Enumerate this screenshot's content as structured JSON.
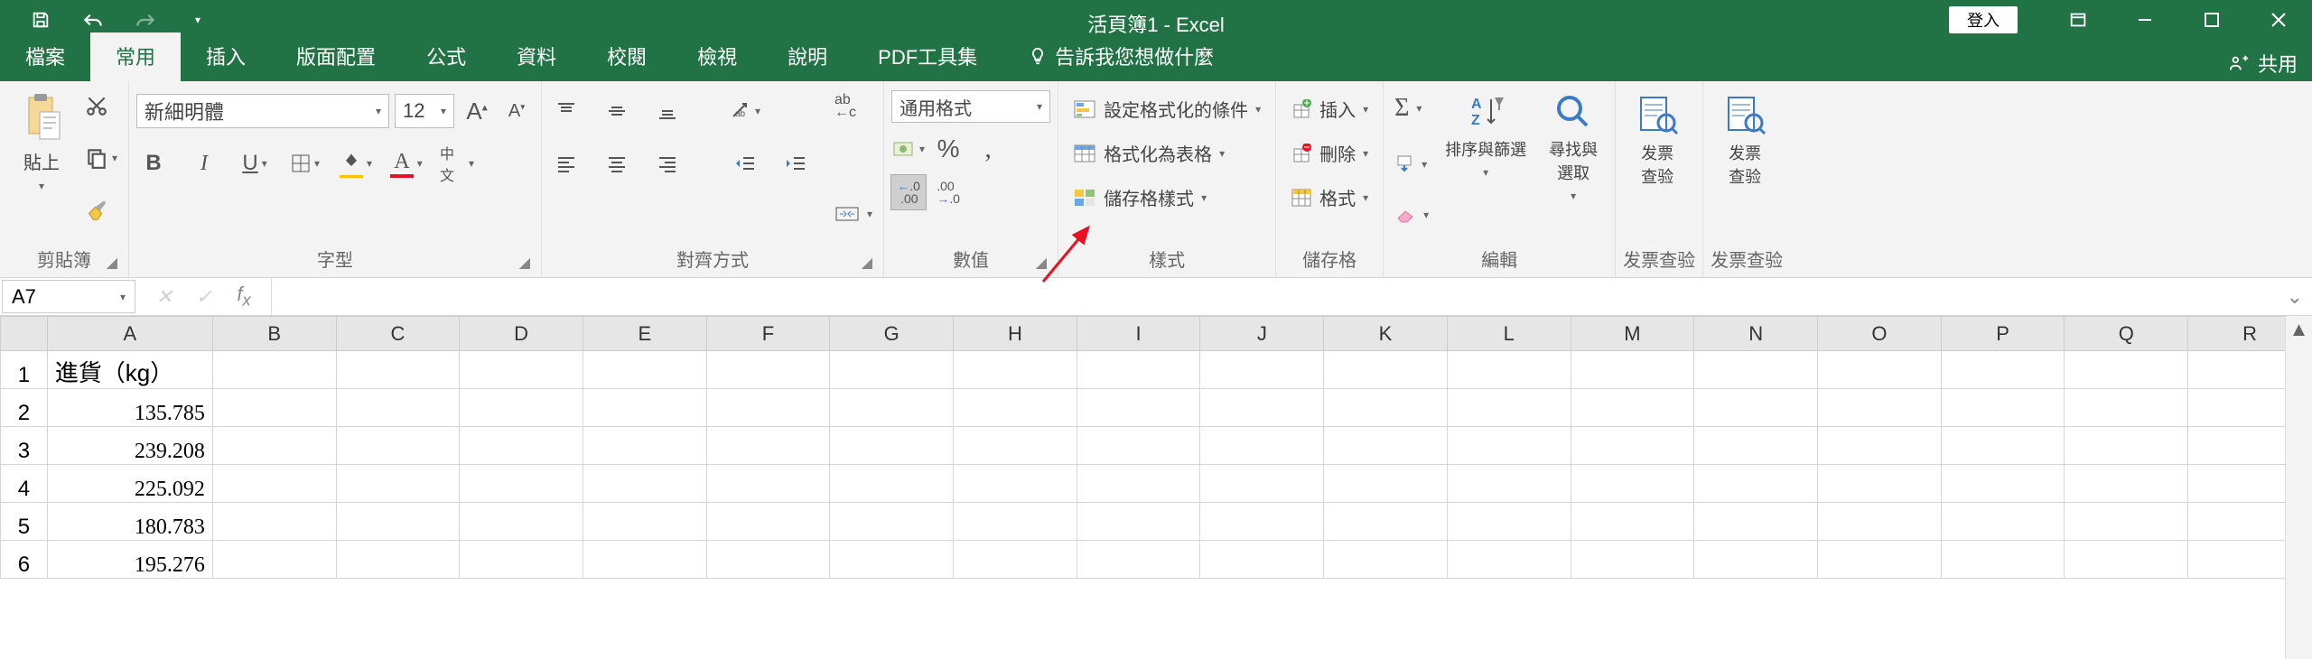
{
  "app_title": "活頁簿1 - Excel",
  "login_button": "登入",
  "share_label": "共用",
  "tellme_placeholder": "告訴我您想做什麼",
  "tabs": {
    "file": "檔案",
    "home": "常用",
    "insert": "插入",
    "layout": "版面配置",
    "formulas": "公式",
    "data": "資料",
    "review": "校閱",
    "view": "檢視",
    "help": "說明",
    "pdf": "PDF工具集"
  },
  "ribbon": {
    "clipboard": {
      "label": "剪貼簿",
      "paste": "貼上"
    },
    "font": {
      "label": "字型",
      "font_name": "新細明體",
      "font_size": "12",
      "phonetic": "中文"
    },
    "alignment": {
      "label": "對齊方式",
      "wrap": "ab"
    },
    "number": {
      "label": "數值",
      "format": "通用格式",
      "inc_decimal": ".00",
      "dec_decimal": ".00"
    },
    "styles": {
      "label": "樣式",
      "cond": "設定格式化的條件",
      "table": "格式化為表格",
      "cell": "儲存格樣式"
    },
    "cells": {
      "label": "儲存格",
      "insert": "插入",
      "delete": "刪除",
      "format": "格式"
    },
    "editing": {
      "label": "編輯",
      "sort_filter": "排序與篩選",
      "find_select": "尋找與\n選取"
    },
    "invoice1": {
      "label": "发票查验",
      "btn": "发票\n查验"
    },
    "invoice2": {
      "label": "发票查验",
      "btn": "发票\n查验"
    }
  },
  "namebox": "A7",
  "formula_value": "",
  "columns": [
    "A",
    "B",
    "C",
    "D",
    "E",
    "F",
    "G",
    "H",
    "I",
    "J",
    "K",
    "L",
    "M",
    "N",
    "O",
    "P",
    "Q",
    "R"
  ],
  "rows": [
    "1",
    "2",
    "3",
    "4",
    "5",
    "6"
  ],
  "cells": {
    "A1": "進貨（kg）",
    "A2": "135.785",
    "A3": "239.208",
    "A4": "225.092",
    "A5": "180.783",
    "A6": "195.276"
  }
}
